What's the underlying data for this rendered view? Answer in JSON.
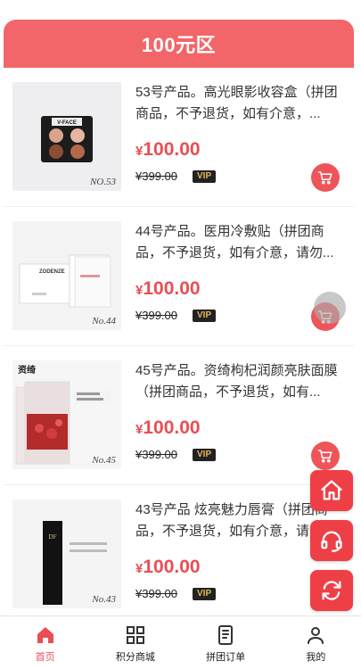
{
  "header": {
    "title": "100元区"
  },
  "products": [
    {
      "no": "NO.53",
      "name": "53号产品。高光眼影收容盒（拼团商品，不予退货，如有介意，...",
      "currency": "¥",
      "price": "100.00",
      "old_price": "¥399.00",
      "badge": "VIP",
      "box_label": "V-FACE"
    },
    {
      "no": "No.44",
      "name": "44号产品。医用冷敷贴（拼团商品，不予退货，如有介意，请勿...",
      "currency": "¥",
      "price": "100.00",
      "old_price": "¥399.00",
      "badge": "VIP",
      "box_label": "ZODENZE"
    },
    {
      "no": "No.45",
      "name": "45号产品。资绮枸杞润颜亮肤面膜（拼团商品，不予退货，如有...",
      "currency": "¥",
      "price": "100.00",
      "old_price": "¥399.00",
      "badge": "VIP",
      "box_label": "资绮"
    },
    {
      "no": "No.43",
      "name": "43号产品 炫亮魅力唇膏（拼团商品，不予退货，如有介意，请...",
      "currency": "¥",
      "price": "100.00",
      "old_price": "¥399.00",
      "badge": "VIP",
      "box_label": "DF"
    }
  ],
  "floating": {
    "home": "home-icon",
    "service": "headset-icon",
    "refresh": "refresh-icon"
  },
  "tabbar": [
    {
      "label": "首页",
      "icon": "home-icon",
      "active": true
    },
    {
      "label": "积分商城",
      "icon": "grid-icon",
      "active": false
    },
    {
      "label": "拼团订单",
      "icon": "order-icon",
      "active": false
    },
    {
      "label": "我的",
      "icon": "user-icon",
      "active": false
    }
  ],
  "colors": {
    "accent": "#ef5459",
    "header": "#f2666a",
    "price": "#e94e55",
    "vip_text": "#e1b85a"
  }
}
